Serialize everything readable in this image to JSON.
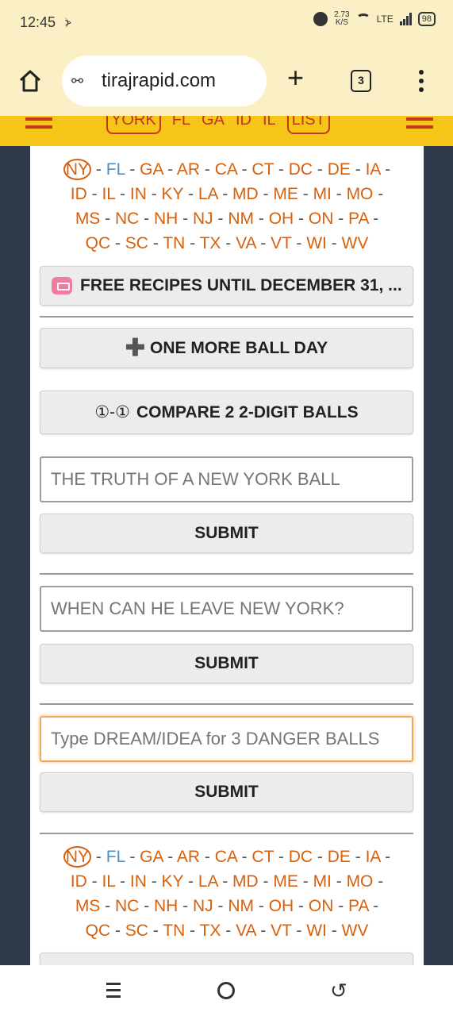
{
  "status_bar": {
    "time": "12:45",
    "network_speed_value": "2.73",
    "network_speed_unit": "K/S",
    "lte": "LTE",
    "battery": "98"
  },
  "browser": {
    "url": "tirajrapid.com",
    "tab_count": "3"
  },
  "site_header": {
    "nav_items": [
      "YORK",
      "FL",
      "GA",
      "ID",
      "IL",
      "LIST"
    ]
  },
  "states_row_1": [
    "NY",
    "FL",
    "GA",
    "AR",
    "CA",
    "CT",
    "DC",
    "DE",
    "IA"
  ],
  "states_row_2": [
    "ID",
    "IL",
    "IN",
    "KY",
    "LA",
    "MD",
    "ME",
    "MI",
    "MO"
  ],
  "states_row_3": [
    "MS",
    "NC",
    "NH",
    "NJ",
    "NM",
    "OH",
    "ON",
    "PA"
  ],
  "states_row_4": [
    "QC",
    "SC",
    "TN",
    "TX",
    "VA",
    "VT",
    "WI",
    "WV"
  ],
  "buttons": {
    "free_recipes": "FREE RECIPES UNTIL DECEMBER 31, ...",
    "one_more_ball_day": "ONE MORE BALL DAY",
    "compare_prefix": "①-①",
    "compare": "COMPARE 2 2-DIGIT BALLS",
    "submit": "SUBMIT"
  },
  "inputs": {
    "truth_placeholder": "THE TRUTH OF A NEW YORK BALL",
    "leave_placeholder": "WHEN CAN HE LEAVE NEW YORK?",
    "dream_placeholder": "Type DREAM/IDEA for 3 DANGER BALLS"
  },
  "colors": {
    "accent": "#d9600a",
    "header_yellow": "#f5c518",
    "browser_bg": "#fbefc6"
  }
}
